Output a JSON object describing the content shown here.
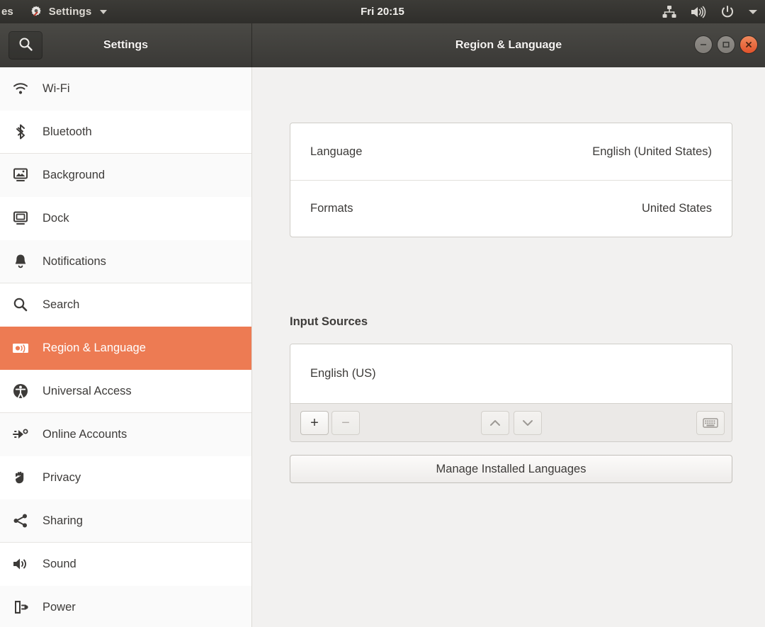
{
  "topbar": {
    "activities_label": "es",
    "app_icon": "settings-gear-icon",
    "app_name": "Settings",
    "menu_caret": "chevron-down-icon",
    "clock": "Fri 20:15",
    "indicators": [
      {
        "name": "network-wired-icon"
      },
      {
        "name": "volume-icon"
      },
      {
        "name": "power-icon"
      },
      {
        "name": "system-menu-chevron-icon"
      }
    ]
  },
  "headerbar": {
    "search_icon": "search-icon",
    "sidebar_title": "Settings",
    "window_title": "Region & Language",
    "window_buttons": [
      {
        "name": "minimize-button",
        "glyph": "−"
      },
      {
        "name": "maximize-button",
        "glyph": "□"
      },
      {
        "name": "close-button",
        "glyph": "×"
      }
    ]
  },
  "sidebar": {
    "items": [
      {
        "label": "Wi-Fi",
        "icon": "wifi-icon"
      },
      {
        "label": "Bluetooth",
        "icon": "bluetooth-icon"
      },
      {
        "label": "Background",
        "icon": "background-icon"
      },
      {
        "label": "Dock",
        "icon": "dock-icon"
      },
      {
        "label": "Notifications",
        "icon": "bell-icon"
      },
      {
        "label": "Search",
        "icon": "search-icon"
      },
      {
        "label": "Region & Language",
        "icon": "region-language-icon"
      },
      {
        "label": "Universal Access",
        "icon": "accessibility-icon"
      },
      {
        "label": "Online Accounts",
        "icon": "online-accounts-icon"
      },
      {
        "label": "Privacy",
        "icon": "hand-icon"
      },
      {
        "label": "Sharing",
        "icon": "share-icon"
      },
      {
        "label": "Sound",
        "icon": "sound-icon"
      },
      {
        "label": "Power",
        "icon": "power-plug-icon"
      }
    ],
    "selected_index": 6
  },
  "main": {
    "rows": [
      {
        "label": "Language",
        "value": "English (United States)"
      },
      {
        "label": "Formats",
        "value": "United States"
      }
    ],
    "input_sources": {
      "title": "Input Sources",
      "items": [
        "English (US)"
      ],
      "toolbar": {
        "add": "+",
        "remove": "−",
        "move_up": "⌃",
        "move_down": "⌄",
        "show_layout": "keyboard-icon"
      }
    },
    "manage_button": "Manage Installed Languages"
  },
  "colors": {
    "accent": "#ed7b53",
    "close_button": "#e2522a",
    "topbar_bg": "#35342f",
    "content_bg": "#f2f1f0"
  }
}
